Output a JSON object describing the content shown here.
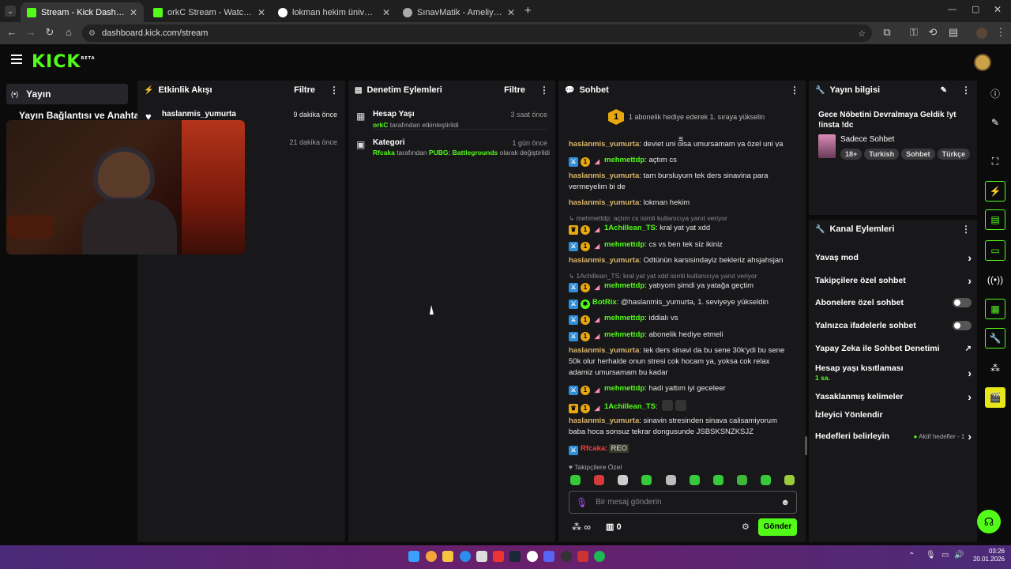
{
  "browser": {
    "tabs": [
      {
        "label": "Stream - Kick Dashboard",
        "favicon": "kick-icon",
        "active": true
      },
      {
        "label": "orkC Stream - Watch Live on Ki",
        "favicon": "kick-icon",
        "active": false
      },
      {
        "label": "lokman hekim üniversitesi - Go",
        "favicon": "google-icon",
        "active": false
      },
      {
        "label": "SınavMatik - Ameliyathane ve Y",
        "favicon": "web-icon",
        "active": false
      }
    ],
    "url": "dashboard.kick.com/stream"
  },
  "header": {
    "logo": "KICK",
    "logo_sup": "BETA"
  },
  "sidebar": {
    "item_label": "Yayın",
    "overlay_title": "Yayın Bağlantısı ve Anahtarı"
  },
  "activity": {
    "title": "Etkinlik Akışı",
    "filter": "Filtre",
    "items": [
      {
        "user": "haslanmis_yumurta",
        "time": "9 dakika önce"
      },
      {
        "time": "21 dakika önce"
      }
    ]
  },
  "moderation": {
    "title": "Denetim Eylemleri",
    "filter": "Filtre",
    "items": [
      {
        "title": "Hesap Yaşı",
        "time": "3 saat önce",
        "actor": "orkC",
        "text": "tarafından etkinleştirildi"
      },
      {
        "title": "Kategori",
        "time": "1 gün önce",
        "actor": "Rfcaka",
        "text": "tarafından",
        "category": "PUBG: Battlegrounds",
        "text2": "olarak değiştirildi"
      }
    ]
  },
  "chat": {
    "title": "Sohbet",
    "gift_banner": "1 abonelik hediye ederek 1. sıraya yükselin",
    "gift_rank": "1",
    "messages": [
      {
        "user": "haslanmis_yumurta",
        "text": "deviet uni olsa umursamam ya özel uni ya"
      },
      {
        "user": "mehmettdp",
        "text": "açtım cs"
      },
      {
        "user": "haslanmis_yumurta",
        "text": "tam bursluyum tek ders sinavina para vermeyelim bi de"
      },
      {
        "user": "haslanmis_yumurta",
        "text": "lokman hekim"
      },
      {
        "reply": "mehmettdp: açtım cs isimli kullanıcıya yanıt veriyor"
      },
      {
        "user": "1Achillean_TS",
        "text": "kral yat yat xdd"
      },
      {
        "user": "mehmettdp",
        "text": "cs vs ben tek siz ikiniz"
      },
      {
        "user": "haslanmis_yumurta",
        "text": "Odtünün karsisindayiz bekleriz ahsjahsjan"
      },
      {
        "reply": "1Achillean_TS: kral yat yat xdd isimli kullanıcıya yanıt veriyor"
      },
      {
        "user": "mehmettdp",
        "text": "yatıyom şimdi ya yatağa geçtim"
      },
      {
        "user": "BotRix",
        "text": "@haslanmis_yumurta, 1. seviyeye yükseldin"
      },
      {
        "user": "mehmettdp",
        "text": "iddialı vs"
      },
      {
        "user": "mehmettdp",
        "text": "abonelik hediye etmeli"
      },
      {
        "user": "haslanmis_yumurta",
        "text": "tek ders sinavi da bu sene 30k'ydi bu sene 50k olur herhalde onun stresi cok hocam ya, yoksa cok relax adamiz umursamam bu kadar"
      },
      {
        "user": "mehmettdp",
        "text": "hadi yattım iyi geceleer"
      },
      {
        "user": "1Achillean_TS",
        "text": ""
      },
      {
        "user": "haslanmis_yumurta",
        "text": "sinavin stresinden sinava calisamiyorum baba hoca sonsuz tekrar dongusunde JSBSKSNZKSJZ"
      },
      {
        "user": "Rfcaka",
        "text": "REO"
      }
    ],
    "followers_only": "Takipçilere Özel",
    "input_placeholder": "Bir mesaj gönderin",
    "infinity": "∞",
    "store_count": "0",
    "send": "Gönder"
  },
  "stream_info": {
    "title": "Yayın bilgisi",
    "stream_title": "Gece Nöbetini Devralmaya Geldik !yt !insta !dc",
    "category": "Sadece Sohbet",
    "tags": [
      "18+",
      "Turkish",
      "Sohbet",
      "Türkçe"
    ]
  },
  "channel_actions": {
    "title": "Kanal Eylemleri",
    "items": [
      {
        "label": "Yavaş mod",
        "control": "chevron"
      },
      {
        "label": "Takipçilere özel sohbet",
        "control": "chevron"
      },
      {
        "label": "Abonelere özel sohbet",
        "control": "toggle"
      },
      {
        "label": "Yalnızca ifadelerle sohbet",
        "control": "toggle"
      },
      {
        "label": "Yapay Zeka ile Sohbet Denetimi",
        "control": "chart"
      },
      {
        "label": "Hesap yaşı kısıtlaması",
        "sub": "1 sa.",
        "control": "chevron"
      },
      {
        "label": "Yasaklanmış kelimeler",
        "control": "chevron"
      },
      {
        "label": "İzleyici Yönlendir",
        "control": "none"
      },
      {
        "label": "Hedefleri belirleyin",
        "extra": "Aktif hedefler - 1",
        "control": "chevron"
      }
    ]
  },
  "taskbar": {
    "time": "03:26",
    "date": "20.01.2026"
  },
  "colors": {
    "accent": "#53fc18",
    "panel": "#18181b",
    "background": "#0b0b0c"
  }
}
